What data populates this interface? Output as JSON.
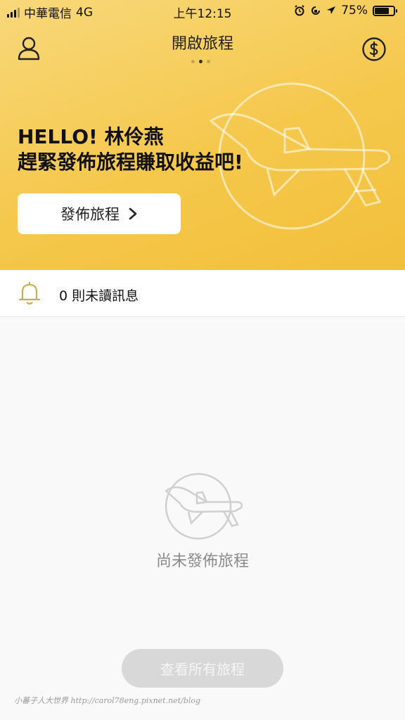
{
  "status_bar": {
    "carrier": "中華電信",
    "network": "4G",
    "time": "上午12:15",
    "battery": "75%"
  },
  "header": {
    "title": "開啟旅程",
    "page_count": 3,
    "active_page": 2
  },
  "hero": {
    "greeting_line1": "HELLO! 林伶燕",
    "greeting_line2": "趕緊發佈旅程賺取收益吧!",
    "publish_button_label": "發佈旅程",
    "background_color": "#f5c84c"
  },
  "notifications": {
    "unread_text": "0 則未讀訊息",
    "bell_color": "#c8ad52"
  },
  "empty_state": {
    "message": "尚未發佈旅程"
  },
  "footer": {
    "view_all_label": "查看所有旅程",
    "watermark": "小蕃子人大世界 http://carol78eng.pixnet.net/blog"
  }
}
